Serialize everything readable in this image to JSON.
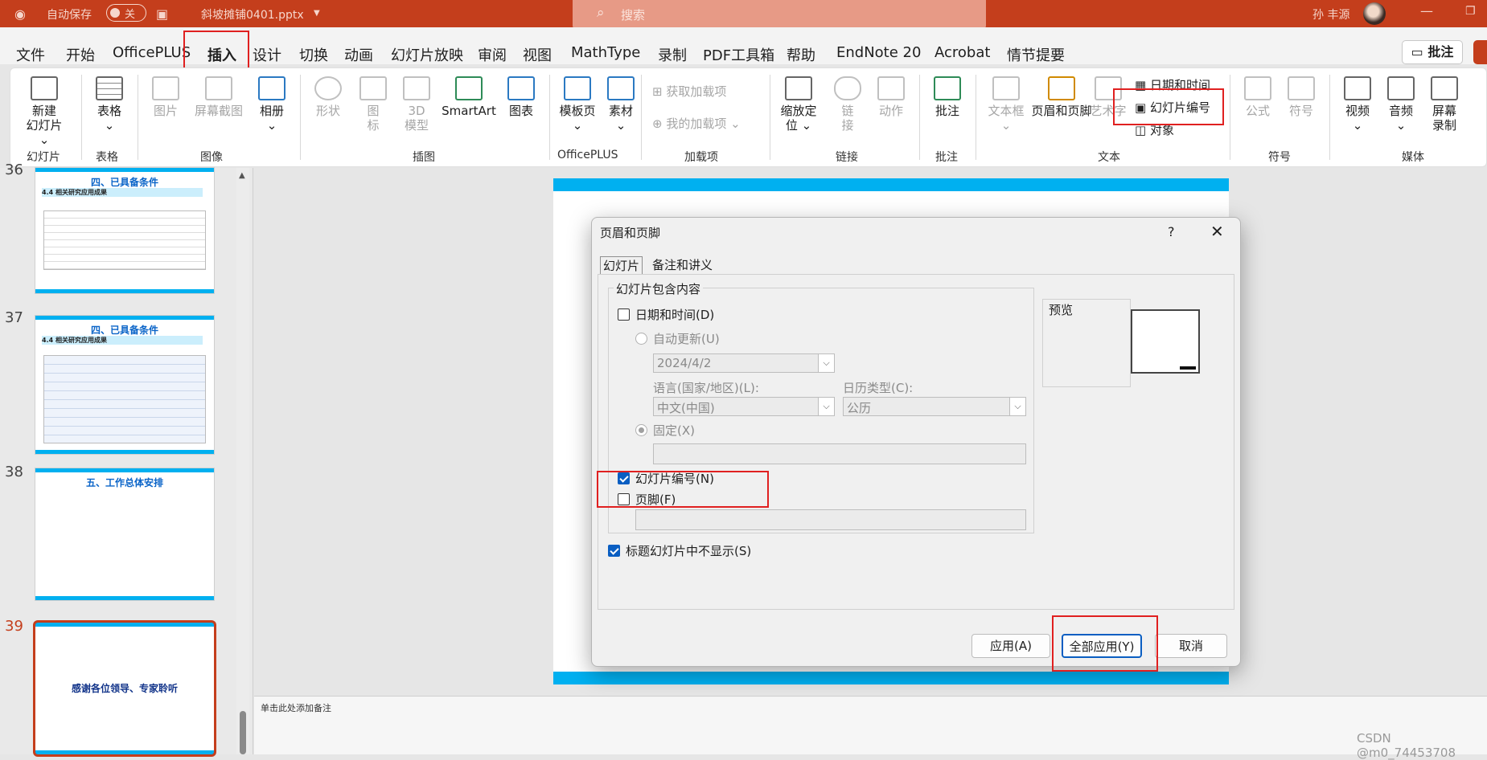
{
  "titlebar": {
    "autosave_label": "自动保存",
    "autosave_state": "关",
    "filename": "斜坡摊铺0401.pptx",
    "search_placeholder": "搜索",
    "user_name": "孙 丰源"
  },
  "menu": [
    "文件",
    "开始",
    "OfficePLUS",
    "插入",
    "设计",
    "切换",
    "动画",
    "幻灯片放映",
    "审阅",
    "视图",
    "MathType",
    "录制",
    "PDF工具箱",
    "帮助",
    "EndNote 20",
    "Acrobat",
    "情节提要"
  ],
  "menu_active": "插入",
  "comment_button": "批注",
  "ribbon": {
    "new_slide": "新建\n幻灯片",
    "new_slide_a": "新建",
    "new_slide_b": "幻灯片 ⌄",
    "table": "表格",
    "picture": "图片",
    "screenshot": "屏幕截图",
    "album": "相册",
    "shapes": "形状",
    "icons_a": "图",
    "icons_b": "标",
    "model3d_a": "3D",
    "model3d_b": "模型",
    "smartart": "SmartArt",
    "chart": "图表",
    "template": "模板页",
    "material": "素材",
    "get_addins": "获取加载项",
    "my_addins": "我的加载项",
    "zoom_a": "缩放定",
    "zoom_b": "位 ⌄",
    "link_a": "链",
    "link_b": "接",
    "action": "动作",
    "comment": "批注",
    "textbox": "文本框",
    "header_footer": "页眉和页脚",
    "wordart": "艺术字",
    "datetime": "日期和时间",
    "slide_number": "幻灯片编号",
    "object": "对象",
    "equation": "公式",
    "symbol": "符号",
    "video": "视频",
    "audio": "音频",
    "screenrec_a": "屏幕",
    "screenrec_b": "录制",
    "groups": {
      "slides": "幻灯片",
      "tables": "表格",
      "images": "图像",
      "illustrations": "插图",
      "officeplus": "OfficePLUS",
      "addins": "加载项",
      "links": "链接",
      "comments": "批注",
      "text": "文本",
      "symbols": "符号",
      "media": "媒体"
    }
  },
  "slides": [
    {
      "num": "36",
      "title": "四、已具备条件",
      "subtitle": "4.4 相关研究应用成果"
    },
    {
      "num": "37",
      "title": "四、已具备条件",
      "subtitle": "4.4 相关研究应用成果"
    },
    {
      "num": "38",
      "title": "五、工作总体安排"
    },
    {
      "num": "39",
      "title": "感谢各位领导、专家聆听"
    }
  ],
  "notes_placeholder": "单击此处添加备注",
  "watermark": "CSDN @m0_74453708",
  "dialog": {
    "title": "页眉和页脚",
    "help": "?",
    "close": "✕",
    "tabs": [
      "幻灯片",
      "备注和讲义"
    ],
    "group_label": "幻灯片包含内容",
    "datetime_label": "日期和时间(D)",
    "datetime_checked": false,
    "auto_update_label": "自动更新(U)",
    "date_value": "2024/4/2",
    "language_label": "语言(国家/地区)(L):",
    "language_value": "中文(中国)",
    "calendar_label": "日历类型(C):",
    "calendar_value": "公历",
    "fixed_label": "固定(X)",
    "slide_number_label": "幻灯片编号(N)",
    "slide_number_checked": true,
    "footer_label": "页脚(F)",
    "footer_checked": false,
    "hide_title_label": "标题幻灯片中不显示(S)",
    "hide_title_checked": true,
    "preview_label": "预览",
    "apply": "应用(A)",
    "apply_all": "全部应用(Y)",
    "cancel": "取消"
  },
  "colors": {
    "accent": "#c43e1c",
    "slide_bar": "#00b0f0",
    "highlight_box": "#e02020",
    "check": "#0a5ec2"
  }
}
